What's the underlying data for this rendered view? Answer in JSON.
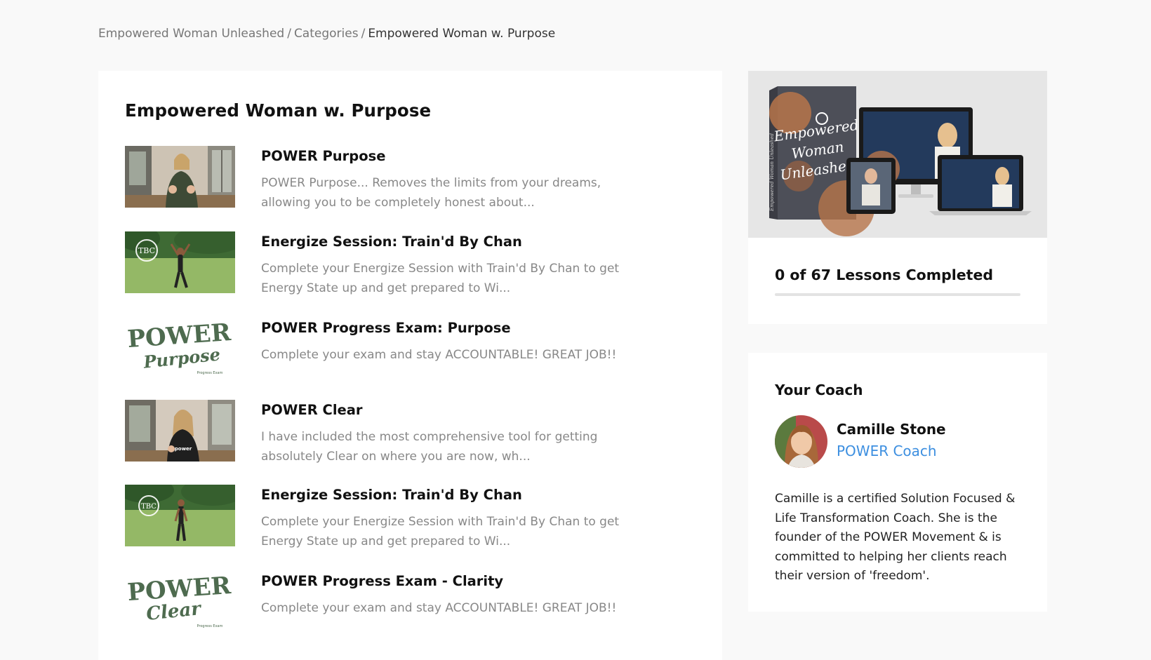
{
  "breadcrumb": {
    "items": [
      "Empowered Woman Unleashed",
      "Categories"
    ],
    "separator": "/",
    "current": "Empowered Woman w. Purpose"
  },
  "category": {
    "title": "Empowered Woman w. Purpose"
  },
  "lessons": [
    {
      "title": "POWER Purpose",
      "description": "POWER Purpose... Removes the limits from your dreams, allowing you to be completely honest about..."
    },
    {
      "title": "Energize Session: Train'd By Chan",
      "description": "Complete your Energize Session with Train'd By Chan to get Energy State up and get prepared to Wi..."
    },
    {
      "title": "POWER Progress Exam: Purpose",
      "description": "Complete your exam and stay ACCOUNTABLE!  GREAT JOB!!"
    },
    {
      "title": "POWER Clear",
      "description": "I have included the most comprehensive tool for getting absolutely Clear on where you are now, wh..."
    },
    {
      "title": "Energize Session: Train'd By Chan",
      "description": "Complete your Energize Session with Train'd By Chan to get Energy State up and get prepared to Wi..."
    },
    {
      "title": "POWER Progress Exam - Clarity",
      "description": "Complete your exam and stay ACCOUNTABLE!  GREAT JOB!!"
    }
  ],
  "thumbnails": {
    "tbc_logo": "TBC",
    "power_word": "POWER",
    "purpose_word": "Purpose",
    "clear_word": "Clear",
    "exam_caption": "Progress Exam",
    "shirt_text": "power"
  },
  "course_image": {
    "box_word_1": "Empowered",
    "box_word_2": "Woman",
    "box_word_3": "Unleashed",
    "spine_text": "Empowered Woman Unleashed"
  },
  "progress": {
    "text": "0 of 67 Lessons Completed",
    "completed": 0,
    "total": 67
  },
  "coach": {
    "heading": "Your Coach",
    "name": "Camille Stone",
    "role": "POWER Coach",
    "bio": "Camille is a certified Solution Focused & Life Transformation Coach. She is the founder of the POWER Movement & is committed to helping her clients reach their version of 'freedom'."
  },
  "colors": {
    "accent": "#3d8fe0",
    "progress_fill": "#5aa0e8",
    "power_green": "#4e6b4f",
    "card_background": "#ffffff",
    "page_background": "#f9f9f9"
  },
  "icons": {
    "coach_avatar": "avatar-photo",
    "course_image": "course-bundle-image"
  }
}
